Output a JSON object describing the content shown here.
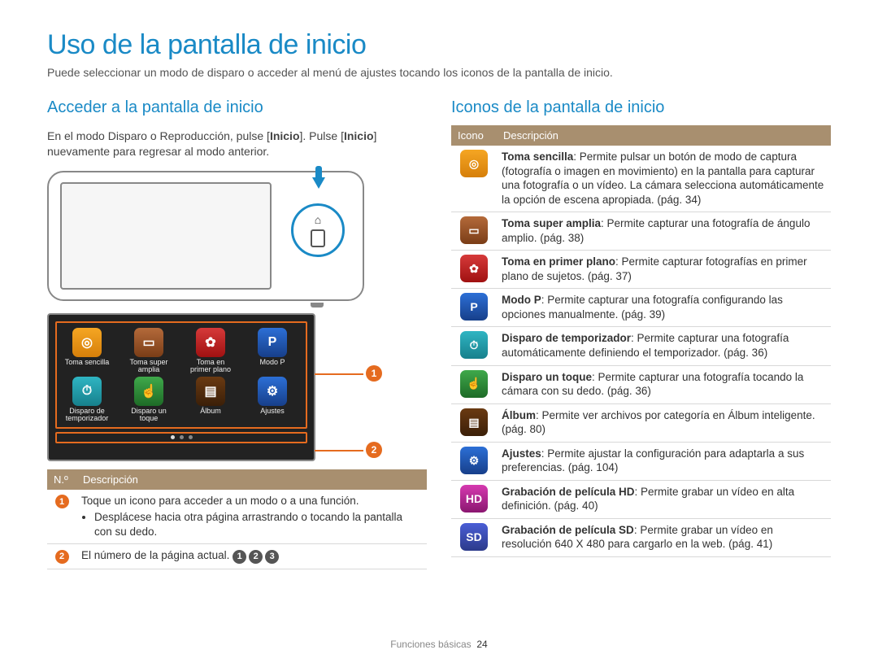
{
  "title": "Uso de la pantalla de inicio",
  "intro": "Puede seleccionar un modo de disparo o acceder al menú de ajustes tocando los iconos de la pantalla de inicio.",
  "left": {
    "heading": "Acceder a la pantalla de inicio",
    "para_pre": "En el modo Disparo o Reproducción, pulse [",
    "para_b1": "Inicio",
    "para_mid": "]. Pulse [",
    "para_b2": "Inicio",
    "para_post": "] nuevamente para regresar al modo anterior.",
    "screen_icons": [
      {
        "label": "Toma sencilla",
        "cls": "ic-orange",
        "glyph": "◎"
      },
      {
        "label": "Toma super amplia",
        "cls": "ic-brown",
        "glyph": "▭"
      },
      {
        "label": "Toma en primer plano",
        "cls": "ic-red",
        "glyph": "✿"
      },
      {
        "label": "Modo P",
        "cls": "ic-blue",
        "glyph": "P"
      },
      {
        "label": "Disparo de temporizador",
        "cls": "ic-teal",
        "glyph": "⏱"
      },
      {
        "label": "Disparo un toque",
        "cls": "ic-green",
        "glyph": "☝"
      },
      {
        "label": "Álbum",
        "cls": "ic-book",
        "glyph": "▤"
      },
      {
        "label": "Ajustes",
        "cls": "ic-gear",
        "glyph": "⚙"
      }
    ],
    "callouts": {
      "1": "1",
      "2": "2"
    },
    "table_headers": {
      "num": "N.º",
      "desc": "Descripción"
    },
    "table_rows": [
      {
        "num": "1",
        "line1": "Toque un icono para acceder a un modo o a una función.",
        "bullet": "Desplácese hacia otra página arrastrando o tocando la pantalla con su dedo."
      },
      {
        "num": "2",
        "line1": "El número de la página actual. ",
        "dots": [
          "1",
          "2",
          "3"
        ]
      }
    ]
  },
  "right": {
    "heading": "Iconos de la pantalla de inicio",
    "table_headers": {
      "icon": "Icono",
      "desc": "Descripción"
    },
    "rows": [
      {
        "cls": "ic-orange",
        "glyph": "◎",
        "bold": "Toma sencilla",
        "rest": ": Permite pulsar un botón de modo de captura (fotografía o imagen en movimiento) en la pantalla para capturar una fotografía o un vídeo. La cámara selecciona automáticamente la opción de escena apropiada. (pág. 34)"
      },
      {
        "cls": "ic-brown",
        "glyph": "▭",
        "bold": "Toma super amplia",
        "rest": ": Permite capturar una fotografía de ángulo amplio. (pág. 38)"
      },
      {
        "cls": "ic-red",
        "glyph": "✿",
        "bold": "Toma en primer plano",
        "rest": ": Permite capturar fotografías en primer plano de sujetos. (pág. 37)"
      },
      {
        "cls": "ic-blue",
        "glyph": "P",
        "bold": "Modo P",
        "rest": ": Permite capturar una fotografía configurando las opciones manualmente. (pág. 39)"
      },
      {
        "cls": "ic-teal",
        "glyph": "⏱",
        "bold": "Disparo de temporizador",
        "rest": ": Permite capturar una fotografía automáticamente definiendo el temporizador. (pág. 36)"
      },
      {
        "cls": "ic-green",
        "glyph": "☝",
        "bold": "Disparo un toque",
        "rest": ": Permite capturar una fotografía tocando la cámara con su dedo. (pág. 36)"
      },
      {
        "cls": "ic-book",
        "glyph": "▤",
        "bold": "Álbum",
        "rest": ": Permite ver archivos por categoría en Álbum inteligente. (pág. 80)"
      },
      {
        "cls": "ic-gear",
        "glyph": "⚙",
        "bold": "Ajustes",
        "rest": ": Permite ajustar la configuración para adaptarla a sus preferencias. (pág. 104)"
      },
      {
        "cls": "ic-pinkh",
        "glyph": "HD",
        "bold": "Grabación de película HD",
        "rest": ": Permite grabar un vídeo en alta definición. (pág. 40)"
      },
      {
        "cls": "ic-bluesd",
        "glyph": "SD",
        "bold": "Grabación de película SD",
        "rest": ": Permite grabar un vídeo en resolución 640 X 480 para cargarlo en la web. (pág. 41)"
      }
    ]
  },
  "footer": {
    "section": "Funciones básicas",
    "page": "24"
  }
}
